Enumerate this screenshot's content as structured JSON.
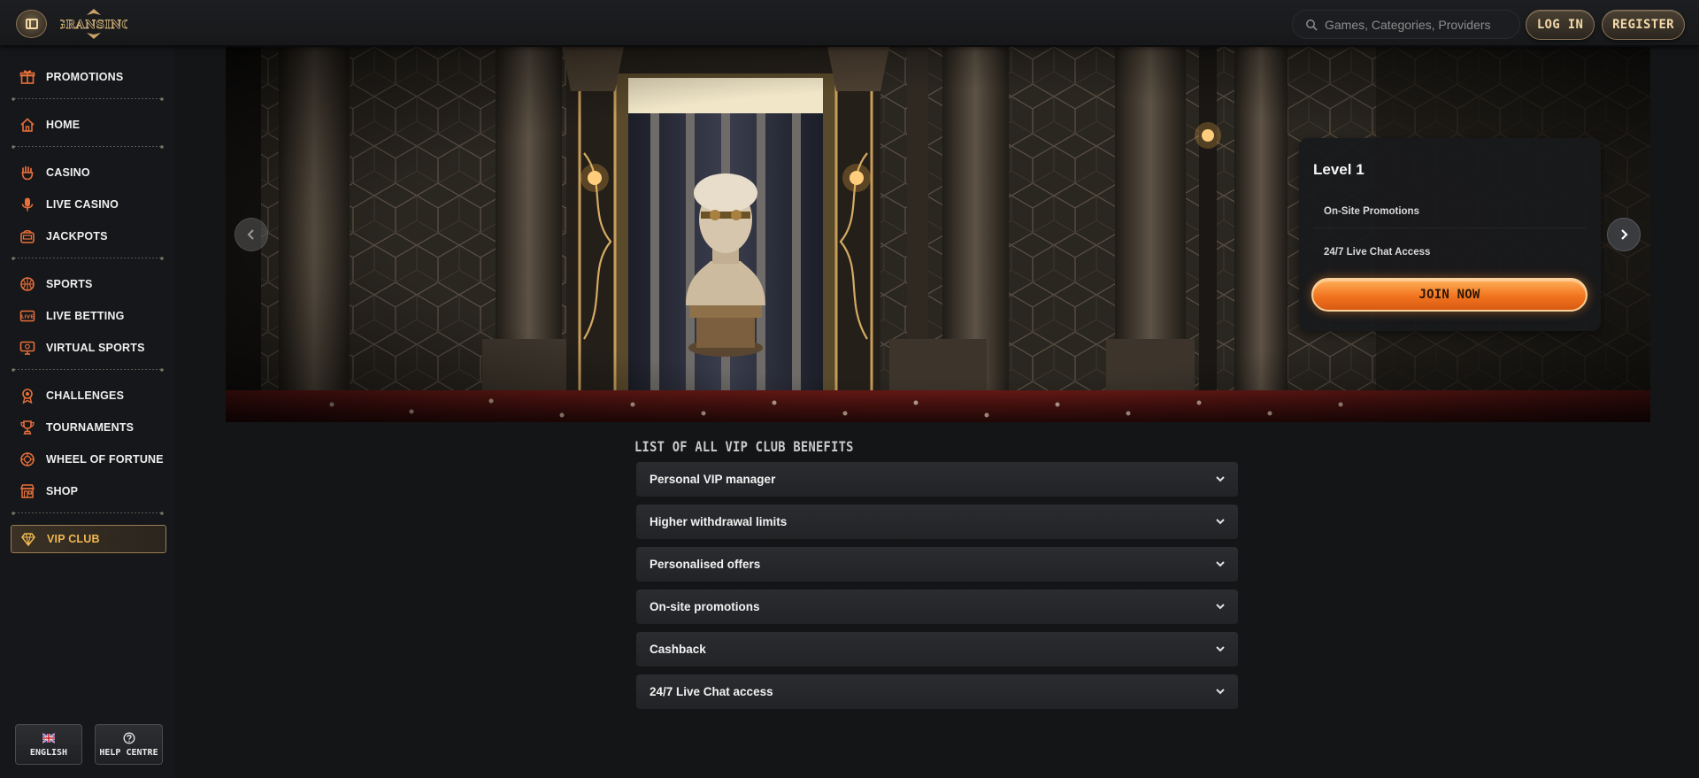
{
  "header": {
    "logo_text": "GRANSINO",
    "search_placeholder": "Games, Categories, Providers",
    "login_label": "LOG IN",
    "register_label": "REGISTER"
  },
  "sidebar": {
    "items": [
      {
        "label": "PROMOTIONS",
        "icon": "gift-icon"
      },
      {
        "label": "HOME",
        "icon": "home-icon"
      },
      {
        "label": "CASINO",
        "icon": "casino-hand-icon"
      },
      {
        "label": "LIVE CASINO",
        "icon": "microphone-icon"
      },
      {
        "label": "JACKPOTS",
        "icon": "slot-machine-icon"
      },
      {
        "label": "SPORTS",
        "icon": "basketball-icon"
      },
      {
        "label": "LIVE BETTING",
        "icon": "live-badge-icon"
      },
      {
        "label": "VIRTUAL SPORTS",
        "icon": "monitor-icon"
      },
      {
        "label": "CHALLENGES",
        "icon": "medal-icon"
      },
      {
        "label": "TOURNAMENTS",
        "icon": "trophy-icon"
      },
      {
        "label": "WHEEL OF FORTUNE",
        "icon": "wheel-icon"
      },
      {
        "label": "SHOP",
        "icon": "shop-icon"
      },
      {
        "label": "VIP CLUB",
        "icon": "diamond-icon"
      }
    ],
    "language_label": "ENGLISH",
    "help_label": "HELP CENTRE"
  },
  "hero": {
    "level_title": "Level 1",
    "benefits": [
      "On-Site Promotions",
      "24/7 Live Chat Access"
    ],
    "join_label": "JOIN NOW"
  },
  "benefits_section": {
    "title": "LIST OF ALL VIP CLUB BENEFITS",
    "items": [
      "Personal VIP manager",
      "Higher withdrawal limits",
      "Personalised offers",
      "On-site promotions",
      "Cashback",
      "24/7 Live Chat access"
    ]
  },
  "colors": {
    "accent_gold": "#f0b74f",
    "join_orange": "#f2741f",
    "background": "#141517"
  }
}
